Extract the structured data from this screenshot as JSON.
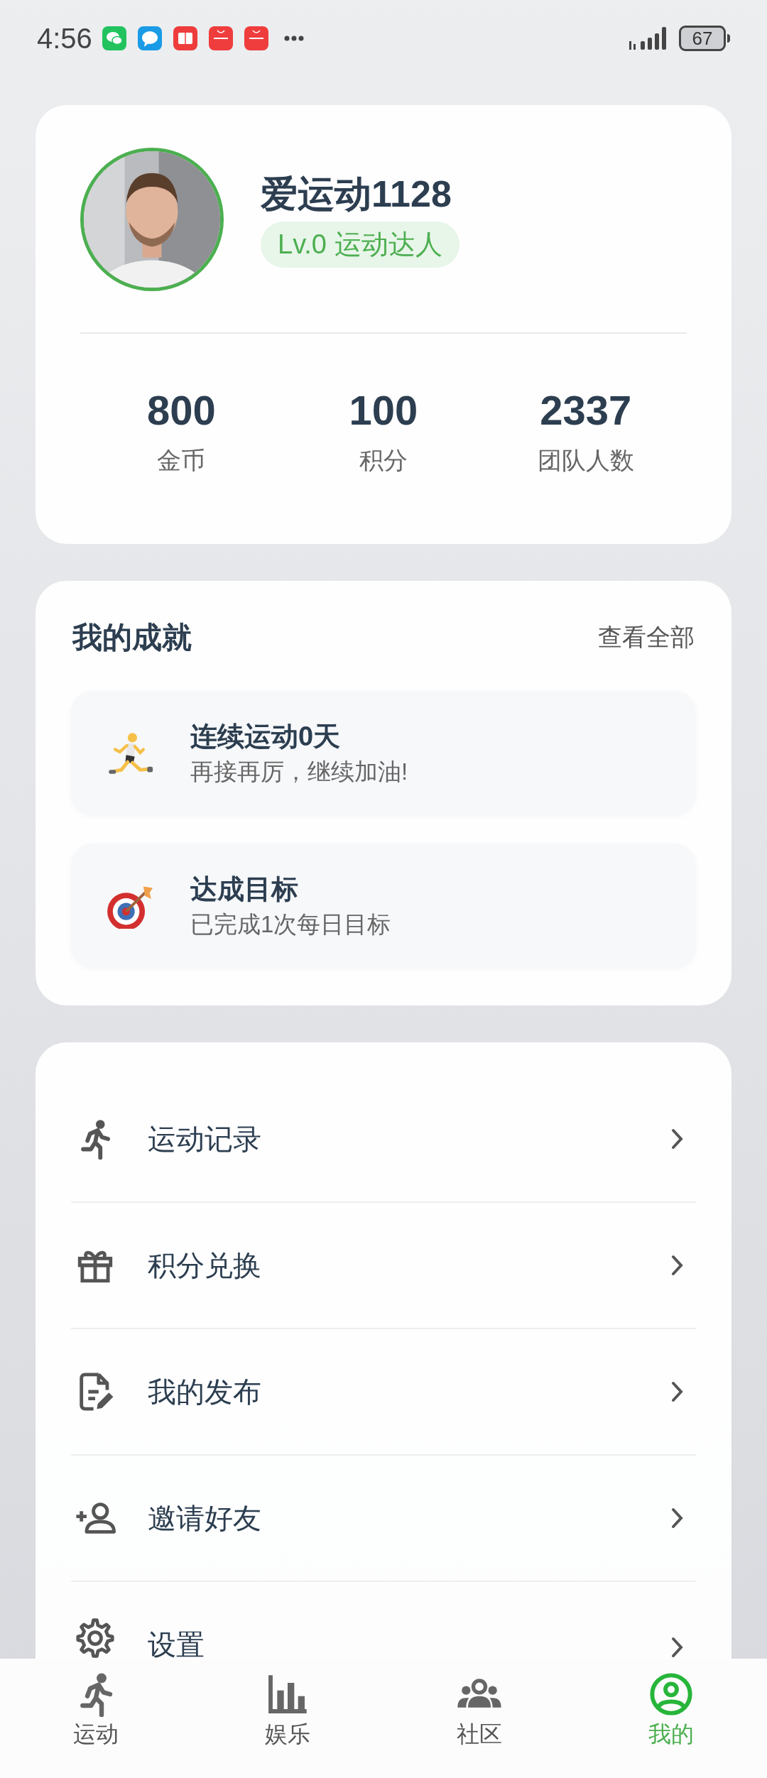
{
  "status_bar": {
    "time": "4:56",
    "notifications": [
      {
        "kind": "chat"
      },
      {
        "kind": "bubble"
      },
      {
        "kind": "book"
      },
      {
        "kind": "bag"
      },
      {
        "kind": "bag"
      }
    ],
    "battery": "67"
  },
  "profile": {
    "name": "爱运动1128",
    "level_badge": "Lv.0 运动达人",
    "stats": [
      {
        "value": "800",
        "label": "金币"
      },
      {
        "value": "100",
        "label": "积分"
      },
      {
        "value": "2337",
        "label": "团队人数"
      }
    ]
  },
  "achievements": {
    "title": "我的成就",
    "view_all": "查看全部",
    "items": [
      {
        "kind": "runner",
        "title": "连续运动0天",
        "subtitle": "再接再厉，继续加油!"
      },
      {
        "kind": "target",
        "title": "达成目标",
        "subtitle": "已完成1次每日目标"
      }
    ]
  },
  "menu": [
    {
      "kind": "run",
      "label": "运动记录"
    },
    {
      "kind": "gift",
      "label": "积分兑换"
    },
    {
      "kind": "doc",
      "label": "我的发布"
    },
    {
      "kind": "invite",
      "label": "邀请好友"
    },
    {
      "kind": "gear",
      "label": "设置"
    }
  ],
  "tab_bar": [
    {
      "kind": "run",
      "label": "运动",
      "selected": false
    },
    {
      "kind": "chart",
      "label": "娱乐",
      "selected": false
    },
    {
      "kind": "group",
      "label": "社区",
      "selected": false
    },
    {
      "kind": "user",
      "label": "我的",
      "selected": true
    }
  ]
}
